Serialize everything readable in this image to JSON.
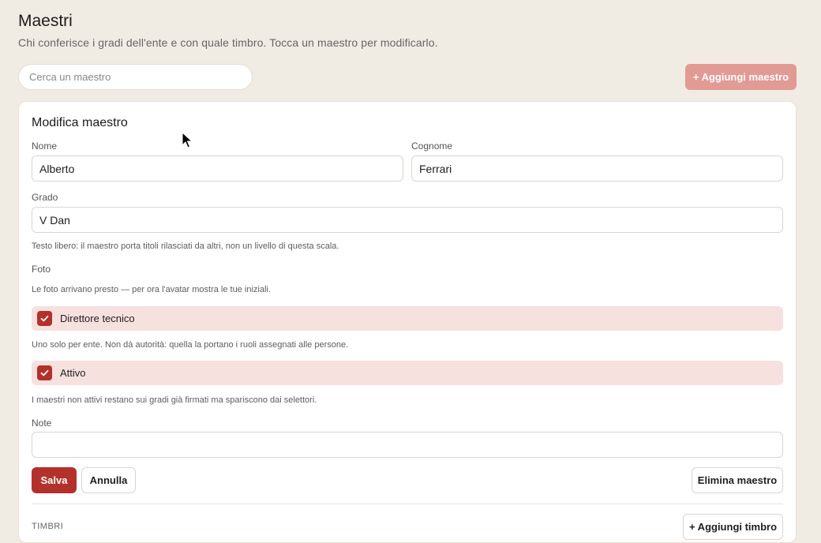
{
  "header": {
    "title": "Maestri",
    "subtitle": "Chi conferisce i gradi dell'ente e con quale timbro. Tocca un maestro per modificarlo."
  },
  "search": {
    "placeholder": "Cerca un maestro",
    "value": ""
  },
  "add_button": {
    "label": "+ Aggiungi maestro"
  },
  "form": {
    "title": "Modifica maestro",
    "nome": {
      "label": "Nome",
      "value": "Alberto"
    },
    "cognome": {
      "label": "Cognome",
      "value": "Ferrari"
    },
    "grado": {
      "label": "Grado",
      "value": "V Dan",
      "hint": "Testo libero: il maestro porta titoli rilasciati da altri, non un livello di questa scala."
    },
    "foto": {
      "label": "Foto",
      "hint": "Le foto arrivano presto — per ora l'avatar mostra le tue iniziali."
    },
    "direttore": {
      "label": "Direttore tecnico",
      "checked": true,
      "hint": "Uno solo per ente. Non dà autorità: quella la portano i ruoli assegnati alle persone."
    },
    "attivo": {
      "label": "Attivo",
      "checked": true,
      "hint": "I maestri non attivi restano sui gradi già firmati ma spariscono dai selettori."
    },
    "note": {
      "label": "Note",
      "value": ""
    },
    "actions": {
      "save": "Salva",
      "cancel": "Annulla",
      "delete": "Elimina maestro"
    },
    "stamps": {
      "section_label": "TIMBRI",
      "add_label": "+ Aggiungi timbro"
    }
  },
  "colors": {
    "accent": "#b3302b",
    "accent_light": "#e19a94",
    "check_bg": "#f6e1df",
    "page_bg": "#f1ece3"
  }
}
